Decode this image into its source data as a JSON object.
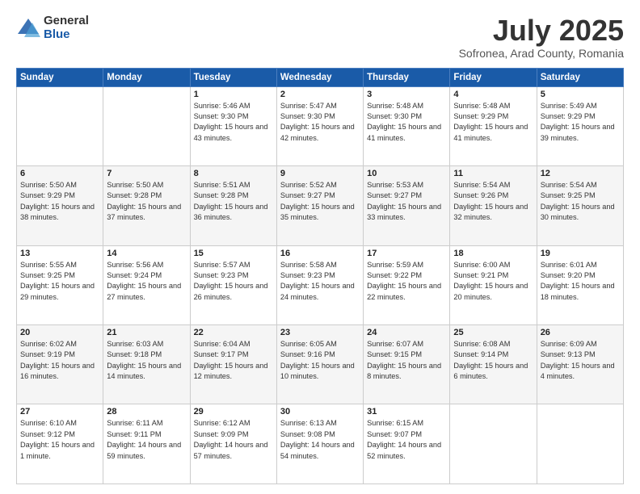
{
  "logo": {
    "general": "General",
    "blue": "Blue"
  },
  "title": "July 2025",
  "subtitle": "Sofronea, Arad County, Romania",
  "days_of_week": [
    "Sunday",
    "Monday",
    "Tuesday",
    "Wednesday",
    "Thursday",
    "Friday",
    "Saturday"
  ],
  "weeks": [
    [
      {
        "day": "",
        "info": ""
      },
      {
        "day": "",
        "info": ""
      },
      {
        "day": "1",
        "info": "Sunrise: 5:46 AM\nSunset: 9:30 PM\nDaylight: 15 hours and 43 minutes."
      },
      {
        "day": "2",
        "info": "Sunrise: 5:47 AM\nSunset: 9:30 PM\nDaylight: 15 hours and 42 minutes."
      },
      {
        "day": "3",
        "info": "Sunrise: 5:48 AM\nSunset: 9:30 PM\nDaylight: 15 hours and 41 minutes."
      },
      {
        "day": "4",
        "info": "Sunrise: 5:48 AM\nSunset: 9:29 PM\nDaylight: 15 hours and 41 minutes."
      },
      {
        "day": "5",
        "info": "Sunrise: 5:49 AM\nSunset: 9:29 PM\nDaylight: 15 hours and 39 minutes."
      }
    ],
    [
      {
        "day": "6",
        "info": "Sunrise: 5:50 AM\nSunset: 9:29 PM\nDaylight: 15 hours and 38 minutes."
      },
      {
        "day": "7",
        "info": "Sunrise: 5:50 AM\nSunset: 9:28 PM\nDaylight: 15 hours and 37 minutes."
      },
      {
        "day": "8",
        "info": "Sunrise: 5:51 AM\nSunset: 9:28 PM\nDaylight: 15 hours and 36 minutes."
      },
      {
        "day": "9",
        "info": "Sunrise: 5:52 AM\nSunset: 9:27 PM\nDaylight: 15 hours and 35 minutes."
      },
      {
        "day": "10",
        "info": "Sunrise: 5:53 AM\nSunset: 9:27 PM\nDaylight: 15 hours and 33 minutes."
      },
      {
        "day": "11",
        "info": "Sunrise: 5:54 AM\nSunset: 9:26 PM\nDaylight: 15 hours and 32 minutes."
      },
      {
        "day": "12",
        "info": "Sunrise: 5:54 AM\nSunset: 9:25 PM\nDaylight: 15 hours and 30 minutes."
      }
    ],
    [
      {
        "day": "13",
        "info": "Sunrise: 5:55 AM\nSunset: 9:25 PM\nDaylight: 15 hours and 29 minutes."
      },
      {
        "day": "14",
        "info": "Sunrise: 5:56 AM\nSunset: 9:24 PM\nDaylight: 15 hours and 27 minutes."
      },
      {
        "day": "15",
        "info": "Sunrise: 5:57 AM\nSunset: 9:23 PM\nDaylight: 15 hours and 26 minutes."
      },
      {
        "day": "16",
        "info": "Sunrise: 5:58 AM\nSunset: 9:23 PM\nDaylight: 15 hours and 24 minutes."
      },
      {
        "day": "17",
        "info": "Sunrise: 5:59 AM\nSunset: 9:22 PM\nDaylight: 15 hours and 22 minutes."
      },
      {
        "day": "18",
        "info": "Sunrise: 6:00 AM\nSunset: 9:21 PM\nDaylight: 15 hours and 20 minutes."
      },
      {
        "day": "19",
        "info": "Sunrise: 6:01 AM\nSunset: 9:20 PM\nDaylight: 15 hours and 18 minutes."
      }
    ],
    [
      {
        "day": "20",
        "info": "Sunrise: 6:02 AM\nSunset: 9:19 PM\nDaylight: 15 hours and 16 minutes."
      },
      {
        "day": "21",
        "info": "Sunrise: 6:03 AM\nSunset: 9:18 PM\nDaylight: 15 hours and 14 minutes."
      },
      {
        "day": "22",
        "info": "Sunrise: 6:04 AM\nSunset: 9:17 PM\nDaylight: 15 hours and 12 minutes."
      },
      {
        "day": "23",
        "info": "Sunrise: 6:05 AM\nSunset: 9:16 PM\nDaylight: 15 hours and 10 minutes."
      },
      {
        "day": "24",
        "info": "Sunrise: 6:07 AM\nSunset: 9:15 PM\nDaylight: 15 hours and 8 minutes."
      },
      {
        "day": "25",
        "info": "Sunrise: 6:08 AM\nSunset: 9:14 PM\nDaylight: 15 hours and 6 minutes."
      },
      {
        "day": "26",
        "info": "Sunrise: 6:09 AM\nSunset: 9:13 PM\nDaylight: 15 hours and 4 minutes."
      }
    ],
    [
      {
        "day": "27",
        "info": "Sunrise: 6:10 AM\nSunset: 9:12 PM\nDaylight: 15 hours and 1 minute."
      },
      {
        "day": "28",
        "info": "Sunrise: 6:11 AM\nSunset: 9:11 PM\nDaylight: 14 hours and 59 minutes."
      },
      {
        "day": "29",
        "info": "Sunrise: 6:12 AM\nSunset: 9:09 PM\nDaylight: 14 hours and 57 minutes."
      },
      {
        "day": "30",
        "info": "Sunrise: 6:13 AM\nSunset: 9:08 PM\nDaylight: 14 hours and 54 minutes."
      },
      {
        "day": "31",
        "info": "Sunrise: 6:15 AM\nSunset: 9:07 PM\nDaylight: 14 hours and 52 minutes."
      },
      {
        "day": "",
        "info": ""
      },
      {
        "day": "",
        "info": ""
      }
    ]
  ]
}
